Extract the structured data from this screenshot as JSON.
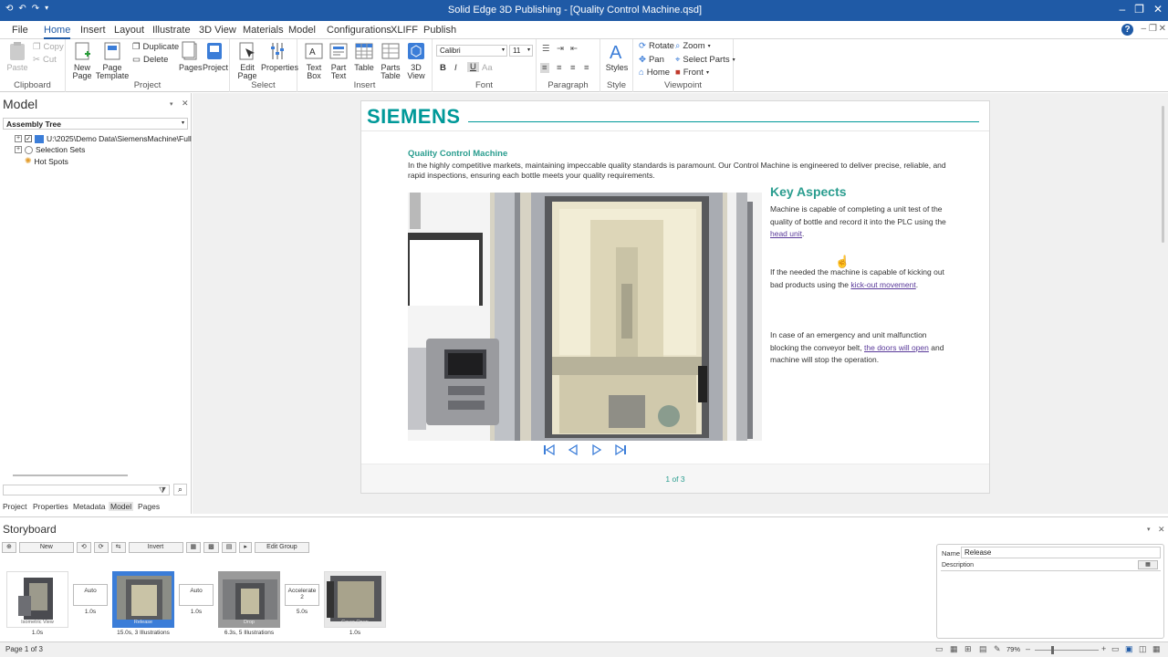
{
  "window": {
    "title": "Solid Edge 3D Publishing  - [Quality Control Machine.qsd]"
  },
  "tabs": [
    "File",
    "Home",
    "Insert",
    "Layout",
    "Illustrate",
    "3D View",
    "Materials",
    "Model",
    "Configurations",
    "XLIFF",
    "Publish"
  ],
  "ribbon": {
    "clipboard": {
      "label": "Clipboard",
      "paste": "Paste",
      "copy": "Copy",
      "cut": "Cut"
    },
    "project": {
      "label": "Project",
      "new_page": "New Page",
      "page_template": "Page Template",
      "duplicate": "Duplicate",
      "delete": "Delete",
      "pages": "Pages",
      "project": "Project"
    },
    "select": {
      "label": "Select",
      "edit_page": "Edit Page",
      "properties": "Properties"
    },
    "insert": {
      "label": "Insert",
      "text_box": "Text Box",
      "part_text": "Part Text",
      "table": "Table",
      "parts_table": "Parts Table",
      "view_3d": "3D View"
    },
    "font": {
      "label": "Font",
      "family": "Calibri",
      "size": "11"
    },
    "paragraph": {
      "label": "Paragraph"
    },
    "style": {
      "label": "Style",
      "styles": "Styles"
    },
    "viewpoint": {
      "label": "Viewpoint",
      "rotate": "Rotate",
      "zoom": "Zoom",
      "pan": "Pan",
      "select_parts": "Select Parts",
      "home": "Home",
      "front": "Front"
    }
  },
  "model_panel": {
    "title": "Model",
    "dropdown": "Assembly Tree",
    "tree": {
      "root": "U:\\2025\\Demo Data\\SiemensMachine\\Full",
      "selection_sets": "Selection Sets",
      "hot_spots": "Hot Spots"
    },
    "tabs": [
      "Project",
      "Properties",
      "Metadata",
      "Model",
      "Pages"
    ],
    "active_tab": "Model"
  },
  "page": {
    "brand": "SIEMENS",
    "title": "Quality Control Machine",
    "intro": "In the highly competitive markets, maintaining impeccable quality standards is paramount. Our Control Machine is engineered to deliver precise, reliable, and rapid inspections, ensuring each bottle meets your quality requirements.",
    "key_title": "Key Aspects",
    "p1_text": "Machine is capable of completing a unit test of the quality of bottle and record it into the PLC using the ",
    "p1_link": "head unit",
    "p1_end": ".",
    "p2_text": "If the needed the machine is capable of kicking out bad products using the ",
    "p2_link": "kick-out movement",
    "p2_end": ".",
    "p3_text": "In case of an emergency and unit malfunction blocking the conveyor belt, ",
    "p3_link": "the doors will open",
    "p3_end": " and machine will stop the operation.",
    "page_count": "1 of 3"
  },
  "storyboard": {
    "title": "Storyboard",
    "buttons": {
      "new": "New",
      "invert": "Invert",
      "edit_group": "Edit Group"
    },
    "thumbs": [
      {
        "caption": "Isometric View",
        "time": "1.0s"
      },
      {
        "caption": "Release",
        "time": "15.0s, 3 Illustrations"
      },
      {
        "caption": "Drop",
        "time": "6.3s, 5 Illustrations"
      },
      {
        "caption": "Cover Open",
        "time": "1.0s"
      }
    ],
    "transitions": [
      {
        "label": "Auto",
        "time": "1.0s"
      },
      {
        "label": "Auto",
        "time": "1.0s"
      },
      {
        "label": "Accelerate 2",
        "time": "5.0s"
      }
    ],
    "props": {
      "name_label": "Name",
      "name_value": "Release",
      "description_label": "Description"
    }
  },
  "status": {
    "page": "Page 1 of 3",
    "zoom": "79%"
  }
}
